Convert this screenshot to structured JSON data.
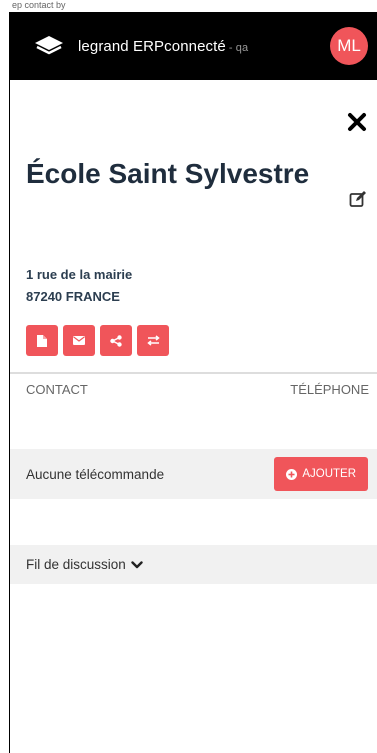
{
  "status_bar": {
    "text": "ep  contact by"
  },
  "header": {
    "brand": "legrand ERPconnecté",
    "env": "- qa",
    "avatar_initials": "ML"
  },
  "detail": {
    "title": "École Saint Sylvestre",
    "address_line1": "1 rue de la mairie",
    "address_line2": "87240 FRANCE"
  },
  "actions": [
    {
      "icon": "document-icon"
    },
    {
      "icon": "envelope-icon"
    },
    {
      "icon": "share-icon"
    },
    {
      "icon": "transfer-icon"
    }
  ],
  "contacts_table": {
    "columns": [
      "CONTACT",
      "TÉLÉPHONE"
    ]
  },
  "remotes": {
    "empty_label": "Aucune télécommande",
    "add_label": "AJOUTER"
  },
  "thread": {
    "label": "Fil de discussion"
  },
  "colors": {
    "accent": "#f0555a",
    "navbar": "#000000",
    "title": "#1f2d3d",
    "row_bg": "#f1f1f1"
  }
}
